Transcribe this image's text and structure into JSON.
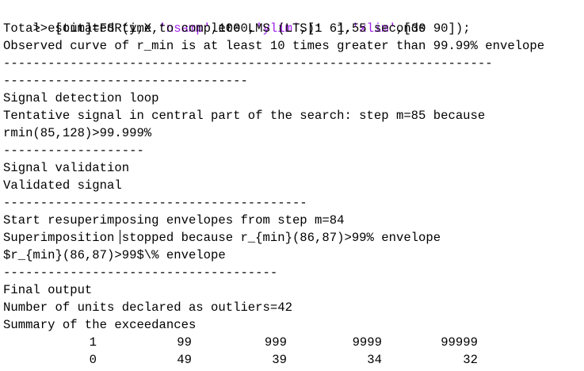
{
  "console": {
    "command": {
      "prompt": ">>",
      "segments": [
        {
          "text": " [out]=FSR(y,X,",
          "kind": "code"
        },
        {
          "text": "'nsamp'",
          "kind": "string"
        },
        {
          "text": ",1000,",
          "kind": "code"
        },
        {
          "text": "'ylim'",
          "kind": "string"
        },
        {
          "text": ",[1 6],",
          "kind": "code"
        },
        {
          "text": "'xlim'",
          "kind": "string"
        },
        {
          "text": ",[30 90]);",
          "kind": "code"
        }
      ],
      "string_color": "#a020f0"
    },
    "lines": {
      "time": "Total estimated time to complete LMS (LTS):  1.55 seconds",
      "observed": "Observed curve of r_min is at least 10 times greater than 99.99% envelope",
      "sep1": "------------------------------------------------------------------",
      "sep2": "---------------------------------",
      "detection_title": "Signal detection loop",
      "tentative": "Tentative signal in central part of the search: step m=85 because",
      "rmin": "rmin(85,128)>99.999%",
      "sep3": "-------------------",
      "validation_title": "Signal validation",
      "validated": "Validated signal",
      "sep4": "-----------------------------------------",
      "resuperimpose": "Start resuperimposing envelopes from step m=84",
      "stopped": "Superimposition stopped because r_{min}(86,87)>99% envelope",
      "tex": "$r_{min}(86,87)>99$\\% envelope",
      "sep5": "-------------------------------------",
      "final_title": "Final output",
      "units": "Number of units declared as outliers=42",
      "summary": "Summary of the exceedances"
    },
    "table": {
      "header": [
        "1",
        "99",
        "999",
        "9999",
        "99999"
      ],
      "row": [
        "0",
        "49",
        "39",
        "34",
        "32"
      ]
    }
  }
}
